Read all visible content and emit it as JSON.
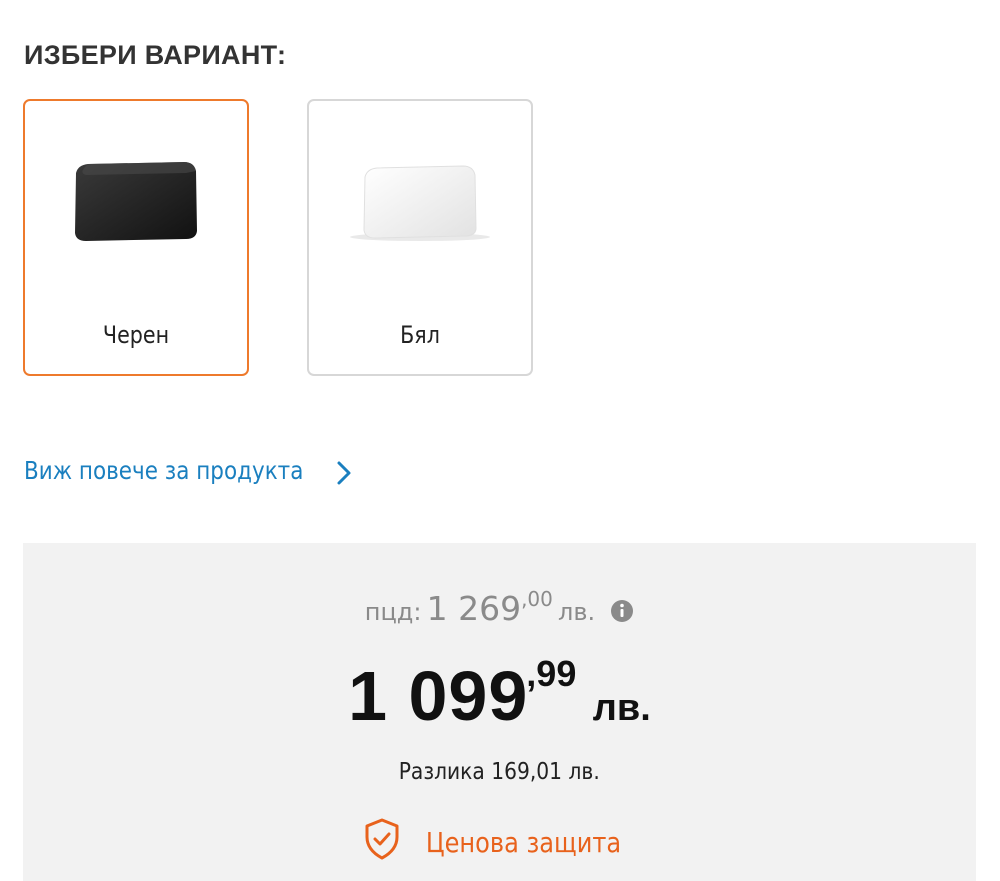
{
  "variant_section": {
    "heading": "ИЗБЕРИ ВАРИАНТ:",
    "variants": [
      {
        "label": "Черен",
        "selected": true,
        "product_color": "#1c1c1c"
      },
      {
        "label": "Бял",
        "selected": false,
        "product_color": "#f1f1f1"
      }
    ]
  },
  "more_link": {
    "label": "Виж повече за продукта",
    "icon": "chevron-right-icon"
  },
  "price": {
    "pcd_label": "пцд:",
    "old_integer": "1 269",
    "old_decimal": ",00",
    "old_currency": "лв.",
    "info_icon": "info-icon",
    "new_integer": "1 099",
    "new_decimal": ",99",
    "new_currency": "лв.",
    "difference": "Разлика 169,01 лв.",
    "protection_label": "Ценова защита",
    "protection_icon": "shield-check-icon"
  },
  "colors": {
    "accent_orange": "#ee7a2c",
    "link_blue": "#1a7fbf",
    "price_box_bg": "#f2f2f2"
  }
}
